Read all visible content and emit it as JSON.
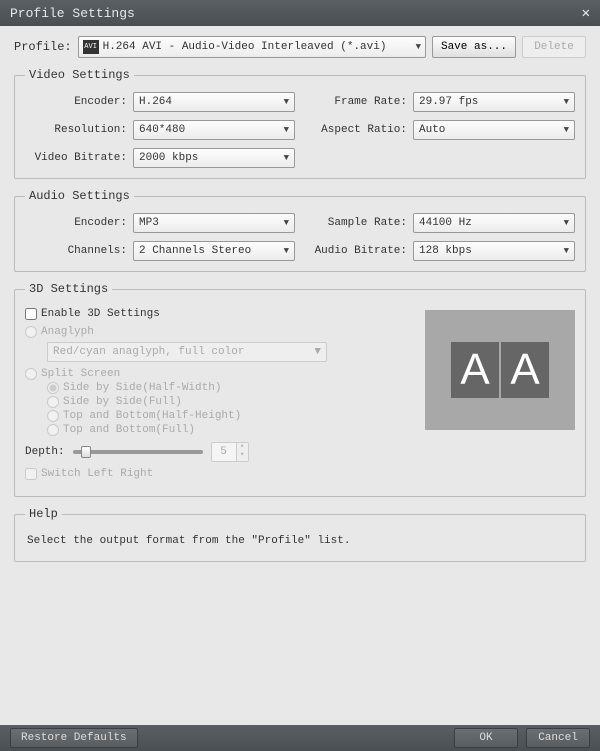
{
  "title": "Profile Settings",
  "profile": {
    "label": "Profile:",
    "icon": "AVI",
    "value": "H.264 AVI - Audio-Video Interleaved (*.avi)",
    "save_as": "Save as...",
    "delete": "Delete"
  },
  "video": {
    "legend": "Video Settings",
    "encoder_label": "Encoder:",
    "encoder": "H.264",
    "resolution_label": "Resolution:",
    "resolution": "640*480",
    "bitrate_label": "Video Bitrate:",
    "bitrate": "2000 kbps",
    "framerate_label": "Frame Rate:",
    "framerate": "29.97 fps",
    "aspect_label": "Aspect Ratio:",
    "aspect": "Auto"
  },
  "audio": {
    "legend": "Audio Settings",
    "encoder_label": "Encoder:",
    "encoder": "MP3",
    "channels_label": "Channels:",
    "channels": "2 Channels Stereo",
    "samplerate_label": "Sample Rate:",
    "samplerate": "44100 Hz",
    "bitrate_label": "Audio Bitrate:",
    "bitrate": "128 kbps"
  },
  "threed": {
    "legend": "3D Settings",
    "enable": "Enable 3D Settings",
    "anaglyph": "Anaglyph",
    "anaglyph_opt": "Red/cyan anaglyph, full color",
    "split": "Split Screen",
    "sbs_half": "Side by Side(Half-Width)",
    "sbs_full": "Side by Side(Full)",
    "tb_half": "Top and Bottom(Half-Height)",
    "tb_full": "Top and Bottom(Full)",
    "depth_label": "Depth:",
    "depth_value": "5",
    "switch": "Switch Left Right",
    "preview_a": "A"
  },
  "help": {
    "legend": "Help",
    "text": "Select the output format from the \"Profile\" list."
  },
  "footer": {
    "restore": "Restore Defaults",
    "ok": "OK",
    "cancel": "Cancel"
  }
}
